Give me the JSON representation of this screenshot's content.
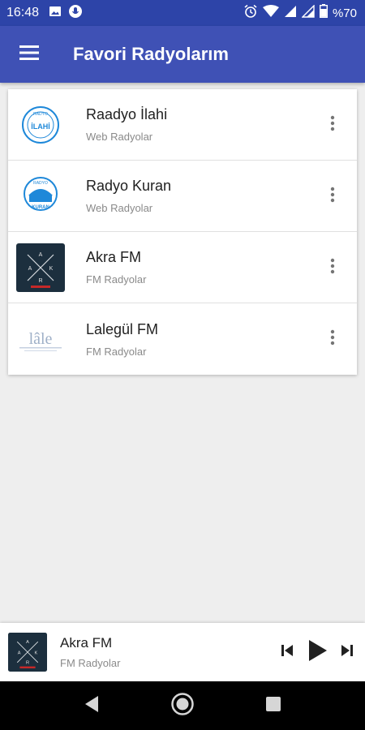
{
  "status_bar": {
    "time": "16:48",
    "battery": "%70",
    "icons": [
      "image-icon",
      "mic-icon",
      "alarm-icon",
      "wifi-icon",
      "signal-icon",
      "signal-icon",
      "battery-icon"
    ]
  },
  "app_bar": {
    "title": "Favori Radyolarım",
    "menu_icon": "hamburger-menu-icon",
    "background": "#3f51b5"
  },
  "stations": [
    {
      "title": "Raadyo İlahi",
      "subtitle": "Web Radyolar",
      "logo_text": "İLAHİ"
    },
    {
      "title": "Radyo Kuran",
      "subtitle": "Web Radyolar",
      "logo_text": "KURAN"
    },
    {
      "title": "Akra FM",
      "subtitle": "FM Radyolar",
      "logo_text": "A K R A"
    },
    {
      "title": "Lalegül FM",
      "subtitle": "FM Radyolar",
      "logo_text": "lâle"
    }
  ],
  "player": {
    "title": "Akra FM",
    "subtitle": "FM Radyolar",
    "controls": [
      "skip-previous-icon",
      "play-icon",
      "skip-next-icon"
    ]
  },
  "nav_bar": {
    "buttons": [
      "back-icon",
      "home-icon",
      "recents-icon"
    ]
  }
}
